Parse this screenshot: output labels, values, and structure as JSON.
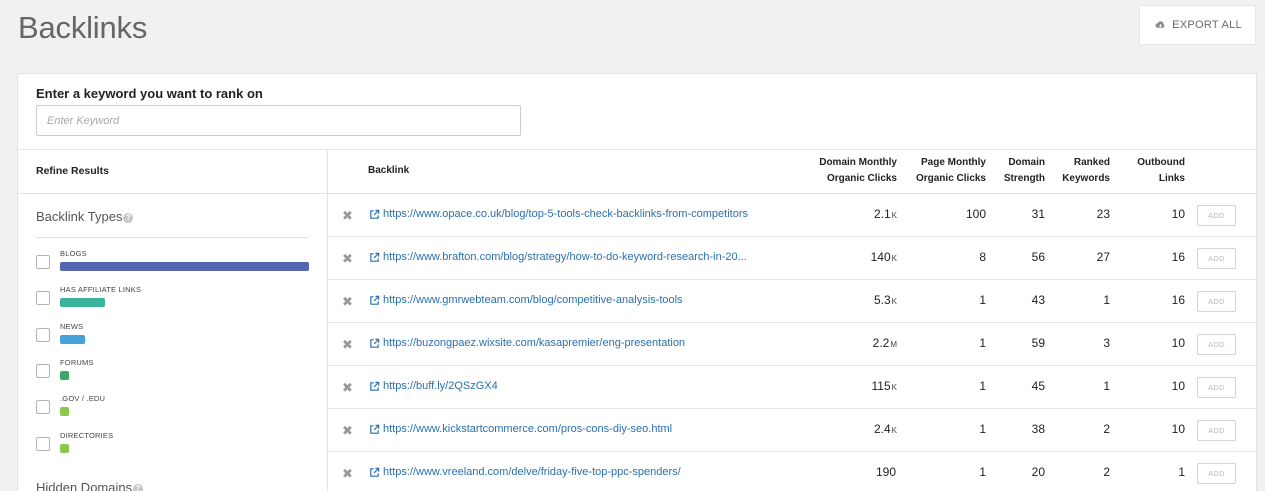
{
  "page": {
    "title": "Backlinks"
  },
  "toolbar": {
    "export_label": "EXPORT ALL",
    "export_icon": "cloud-download-icon"
  },
  "search": {
    "label": "Enter a keyword you want to rank on",
    "placeholder": "Enter Keyword",
    "value": ""
  },
  "sidebar": {
    "refine_title": "Refine Results",
    "backlink_types_title": "Backlink Types",
    "hidden_domains_title": "Hidden Domains",
    "help_glyph": "?",
    "types": [
      {
        "label": "BLOGS",
        "share": 1.0,
        "color": "#5466b0"
      },
      {
        "label": "HAS AFFILIATE LINKS",
        "share": 0.18,
        "color": "#3bb39a"
      },
      {
        "label": "NEWS",
        "share": 0.1,
        "color": "#46a2d9"
      },
      {
        "label": "FORUMS",
        "share": 0.035,
        "color": "#3aa76d"
      },
      {
        "label": ".GOV / .EDU",
        "share": 0.035,
        "color": "#8cc84b"
      },
      {
        "label": "DIRECTORIES",
        "share": 0.035,
        "color": "#8cc84b"
      }
    ]
  },
  "table": {
    "columns": {
      "backlink": "Backlink",
      "domain_monthly_1": "Domain Monthly",
      "domain_monthly_2": "Organic Clicks",
      "page_monthly_1": "Page Monthly",
      "page_monthly_2": "Organic Clicks",
      "domain_strength_1": "Domain",
      "domain_strength_2": "Strength",
      "ranked_keywords_1": "Ranked",
      "ranked_keywords_2": "Keywords",
      "outbound_links_1": "Outbound",
      "outbound_links_2": "Links"
    },
    "remove_glyph": "✖",
    "add_label": "ADD",
    "rows": [
      {
        "url": "https://www.opace.co.uk/blog/top-5-tools-check-backlinks-from-competitors",
        "domain_clicks": "2.1",
        "domain_unit": "K",
        "page_clicks": "100",
        "strength": "31",
        "keywords": "23",
        "outbound": "10"
      },
      {
        "url": "https://www.brafton.com/blog/strategy/how-to-do-keyword-research-in-20...",
        "domain_clicks": "140",
        "domain_unit": "K",
        "page_clicks": "8",
        "strength": "56",
        "keywords": "27",
        "outbound": "16"
      },
      {
        "url": "https://www.gmrwebteam.com/blog/competitive-analysis-tools",
        "domain_clicks": "5.3",
        "domain_unit": "K",
        "page_clicks": "1",
        "strength": "43",
        "keywords": "1",
        "outbound": "16"
      },
      {
        "url": "https://buzongpaez.wixsite.com/kasapremier/eng-presentation",
        "domain_clicks": "2.2",
        "domain_unit": "M",
        "page_clicks": "1",
        "strength": "59",
        "keywords": "3",
        "outbound": "10"
      },
      {
        "url": "https://buff.ly/2QSzGX4",
        "domain_clicks": "115",
        "domain_unit": "K",
        "page_clicks": "1",
        "strength": "45",
        "keywords": "1",
        "outbound": "10"
      },
      {
        "url": "https://www.kickstartcommerce.com/pros-cons-diy-seo.html",
        "domain_clicks": "2.4",
        "domain_unit": "K",
        "page_clicks": "1",
        "strength": "38",
        "keywords": "2",
        "outbound": "10"
      },
      {
        "url": "https://www.vreeland.com/delve/friday-five-top-ppc-spenders/",
        "domain_clicks": "190",
        "domain_unit": "",
        "page_clicks": "1",
        "strength": "20",
        "keywords": "2",
        "outbound": "1"
      }
    ]
  }
}
